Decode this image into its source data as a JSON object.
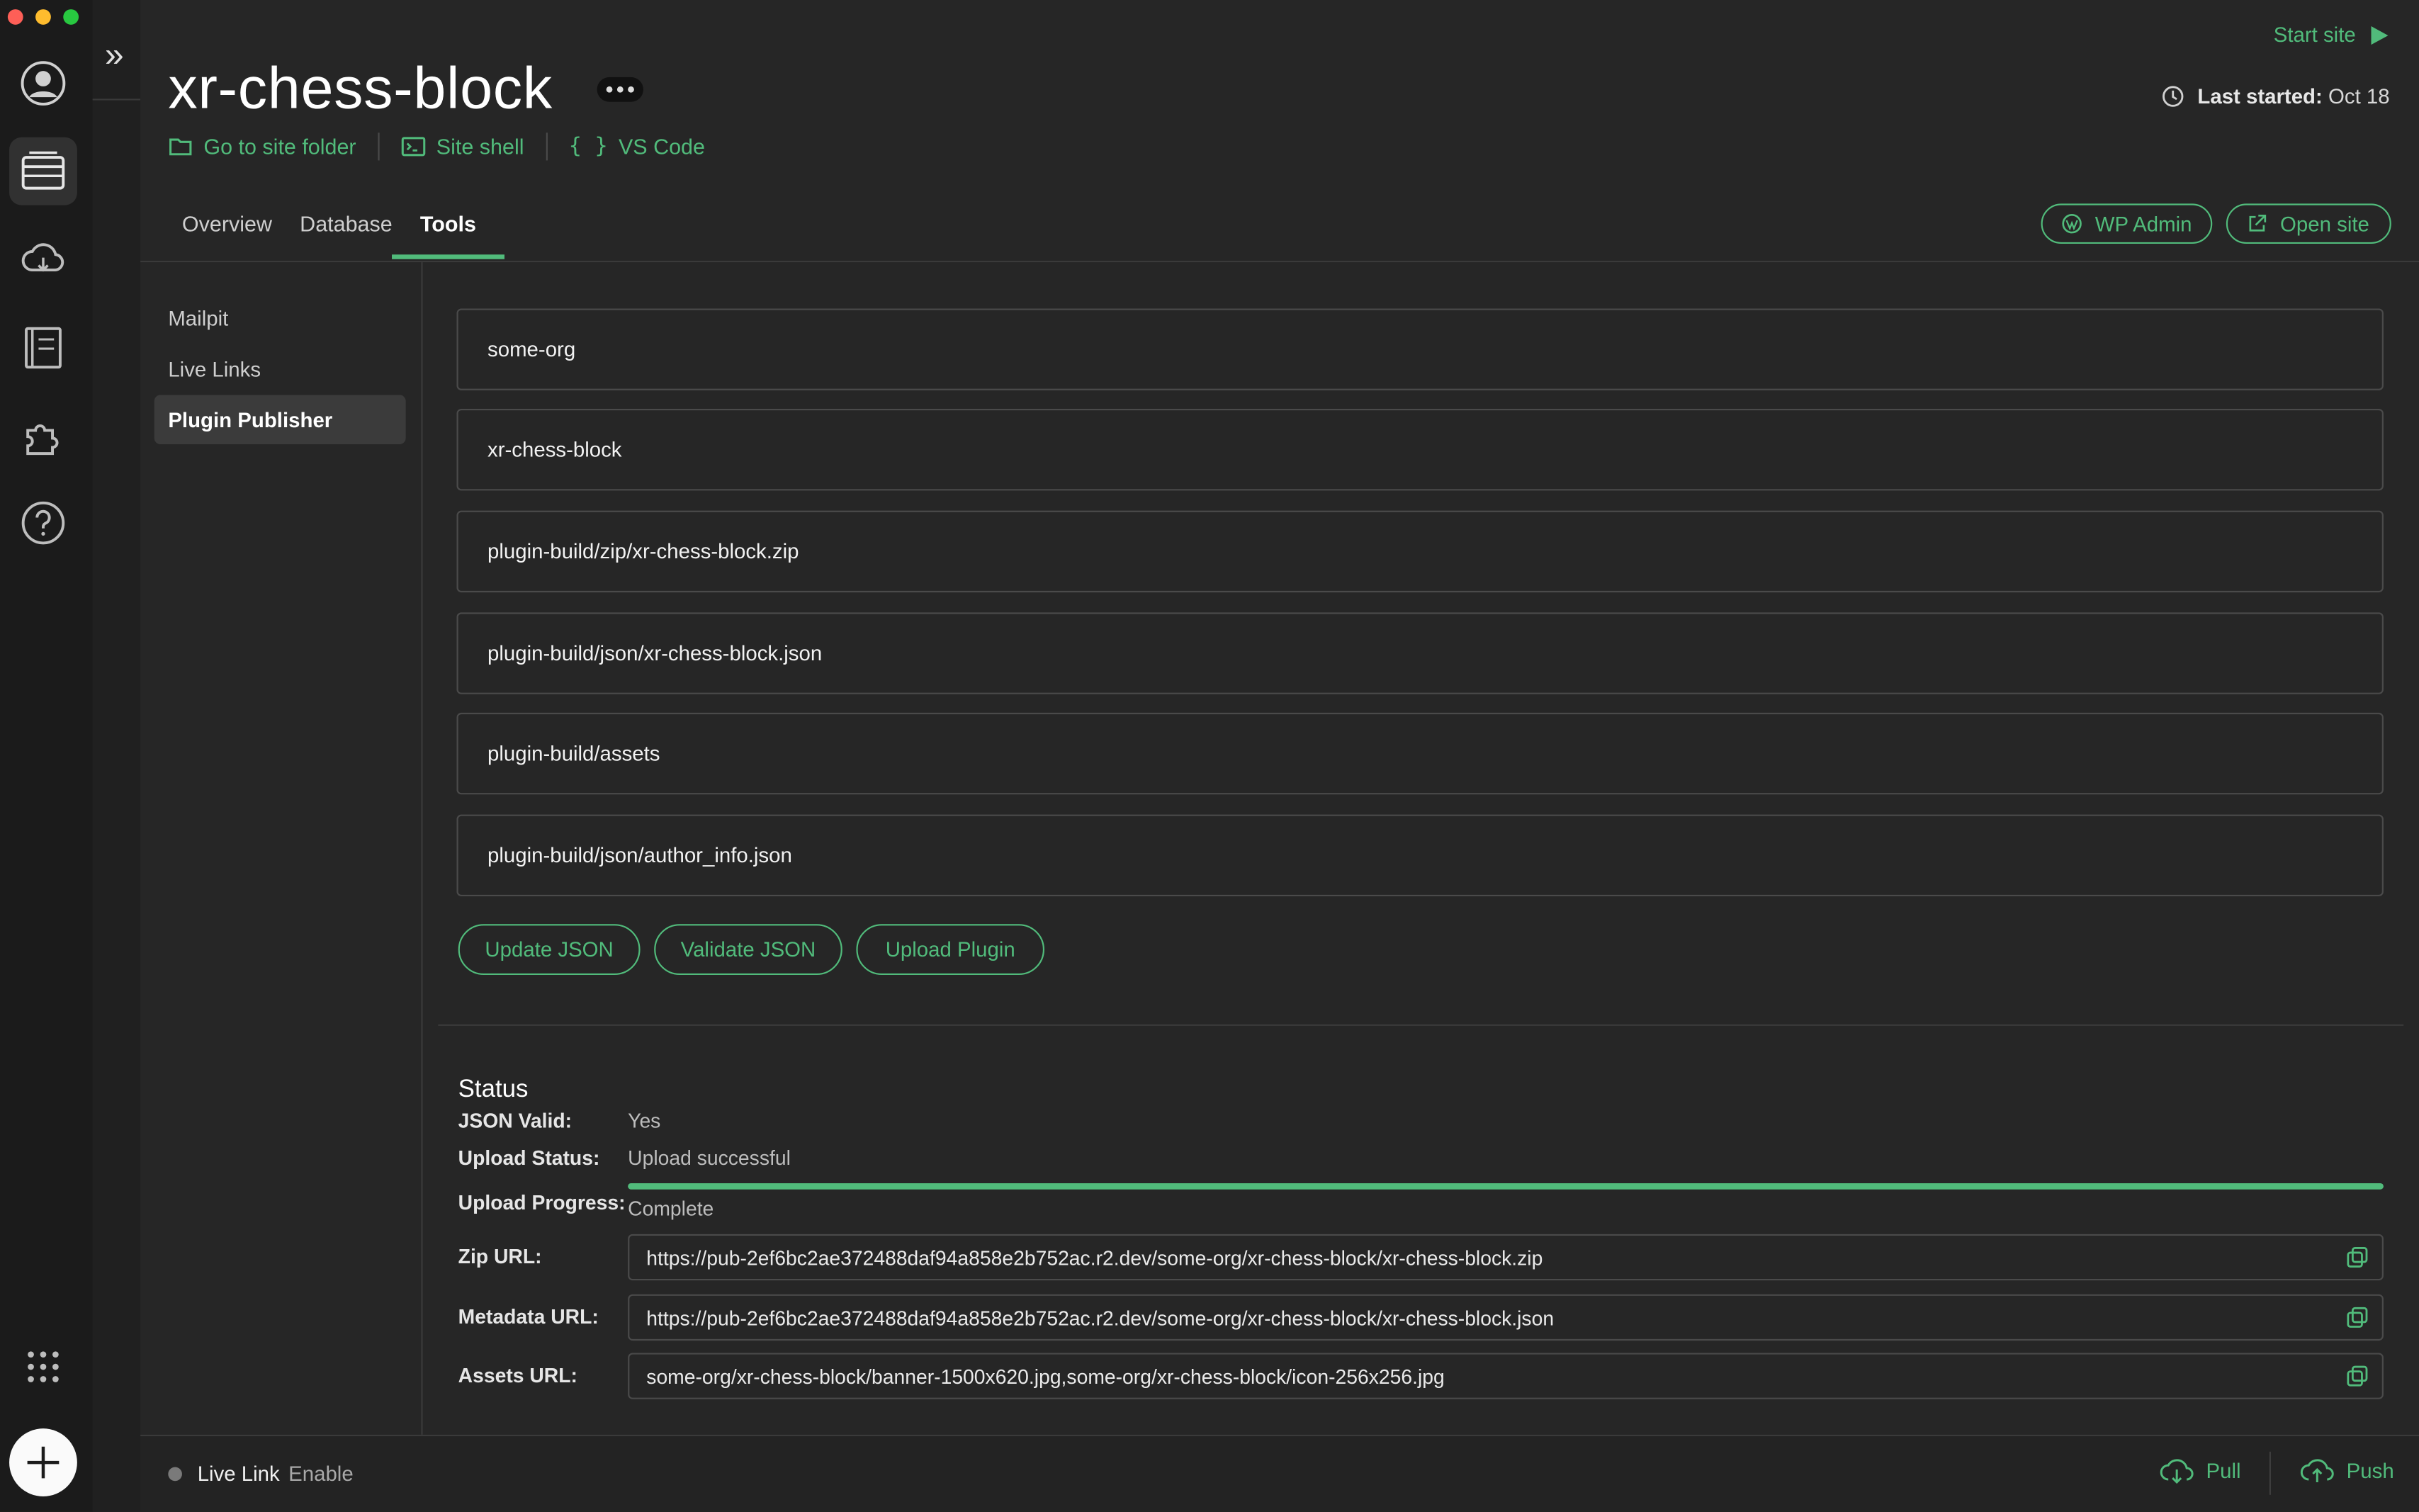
{
  "site": {
    "title": "xr-chess-block",
    "links": {
      "folder": "Go to site folder",
      "shell": "Site shell",
      "vscode": "VS Code"
    },
    "start_site": "Start site",
    "last_started_label": "Last started:",
    "last_started_value": "Oct 18"
  },
  "tabs": [
    "Overview",
    "Database",
    "Tools"
  ],
  "actions": {
    "wp_admin": "WP Admin",
    "open_site": "Open site"
  },
  "subnav": [
    "Mailpit",
    "Live Links",
    "Plugin Publisher"
  ],
  "fields": {
    "org": "some-org",
    "slug": "xr-chess-block",
    "zip_path": "plugin-build/zip/xr-chess-block.zip",
    "json_path": "plugin-build/json/xr-chess-block.json",
    "assets_path": "plugin-build/assets",
    "author_info_path": "plugin-build/json/author_info.json"
  },
  "buttons": {
    "update_json": "Update JSON",
    "validate_json": "Validate JSON",
    "upload_plugin": "Upload Plugin"
  },
  "status": {
    "heading": "Status",
    "json_valid_label": "JSON Valid:",
    "json_valid_value": "Yes",
    "upload_status_label": "Upload Status:",
    "upload_status_value": "Upload successful",
    "upload_progress_label": "Upload Progress:",
    "upload_progress_value": "Complete",
    "upload_progress_fraction": 1.0,
    "zip_url_label": "Zip URL:",
    "zip_url": "https://pub-2ef6bc2ae372488daf94a858e2b752ac.r2.dev/some-org/xr-chess-block/xr-chess-block.zip",
    "metadata_url_label": "Metadata URL:",
    "metadata_url": "https://pub-2ef6bc2ae372488daf94a858e2b752ac.r2.dev/some-org/xr-chess-block/xr-chess-block.json",
    "assets_url_label": "Assets URL:",
    "assets_url": "some-org/xr-chess-block/banner-1500x620.jpg,some-org/xr-chess-block/icon-256x256.jpg"
  },
  "footer": {
    "live_link": "Live Link",
    "enable": "Enable",
    "pull": "Pull",
    "push": "Push"
  },
  "colors": {
    "accent": "#51bb7b",
    "background": "#262626",
    "rail": "#1b1b1b"
  }
}
